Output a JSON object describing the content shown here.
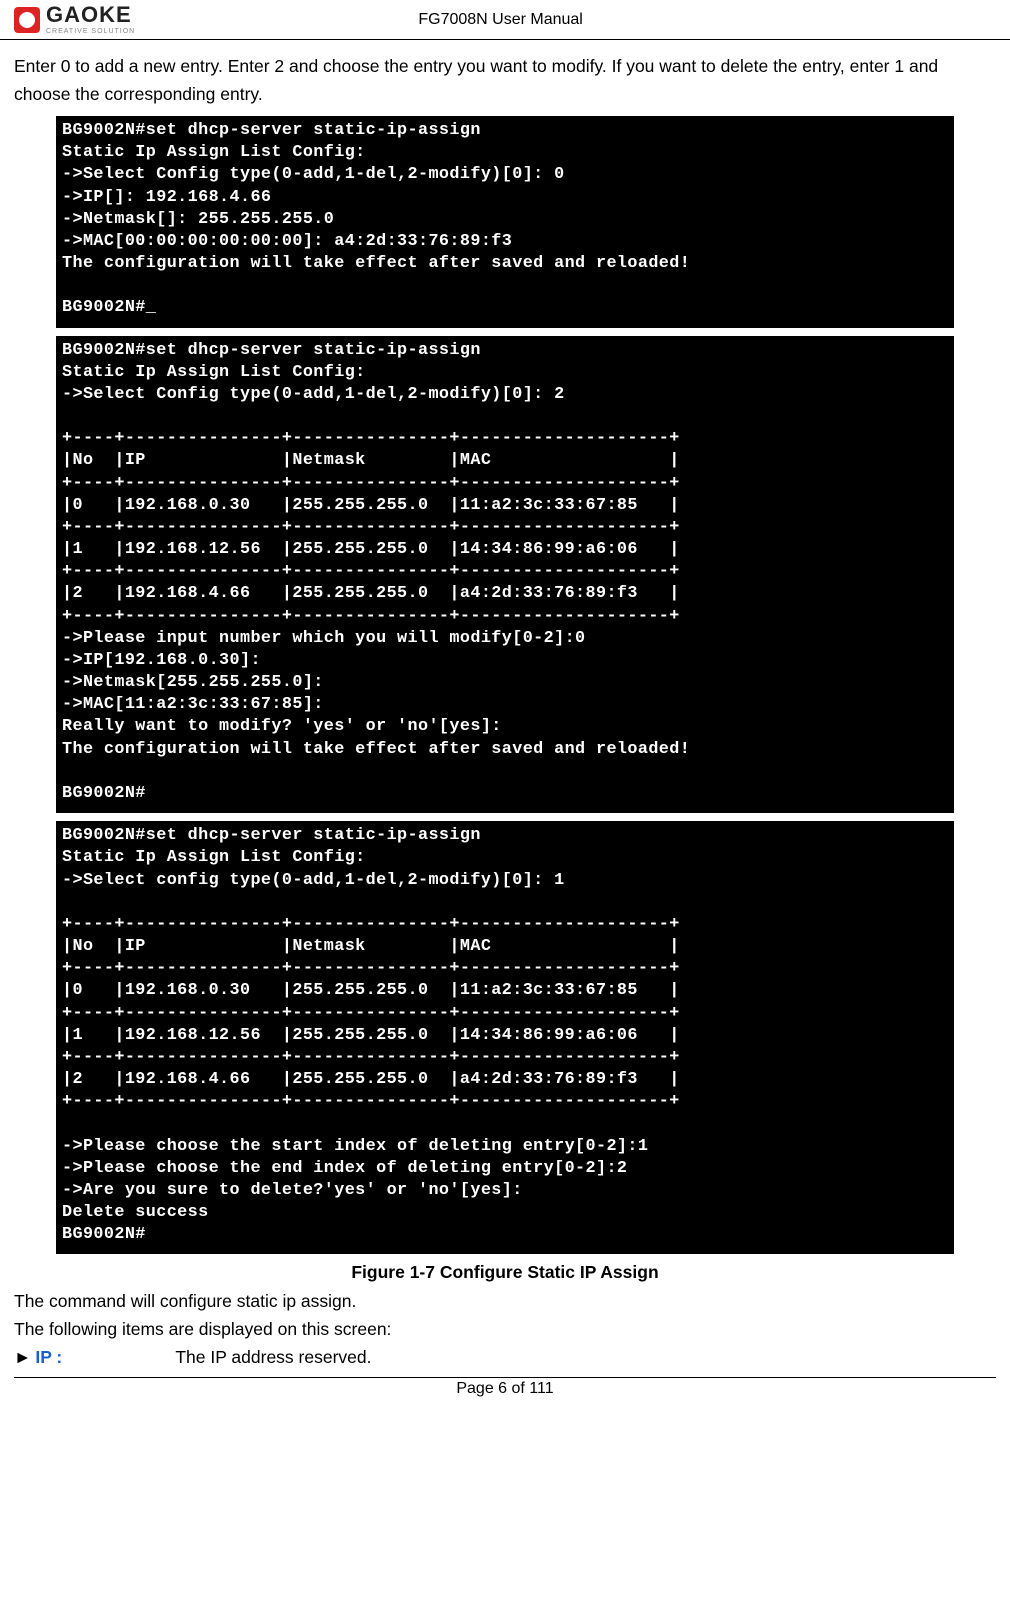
{
  "header": {
    "logo_text": "GAOKE",
    "logo_sub": "CREATIVE SOLUTION",
    "title": "FG7008N User Manual"
  },
  "intro": "Enter 0 to add a new entry. Enter 2 and choose the entry you want to modify. If you want to delete the entry, enter 1 and choose the corresponding entry.",
  "terminals": {
    "t1": "BG9002N#set dhcp-server static-ip-assign\nStatic Ip Assign List Config:\n->Select Config type(0-add,1-del,2-modify)[0]: 0\n->IP[]: 192.168.4.66\n->Netmask[]: 255.255.255.0\n->MAC[00:00:00:00:00:00]: a4:2d:33:76:89:f3\nThe configuration will take effect after saved and reloaded!\n\nBG9002N#_",
    "t2": "BG9002N#set dhcp-server static-ip-assign\nStatic Ip Assign List Config:\n->Select Config type(0-add,1-del,2-modify)[0]: 2\n\n+----+---------------+---------------+--------------------+\n|No  |IP             |Netmask        |MAC                 |\n+----+---------------+---------------+--------------------+\n|0   |192.168.0.30   |255.255.255.0  |11:a2:3c:33:67:85   |\n+----+---------------+---------------+--------------------+\n|1   |192.168.12.56  |255.255.255.0  |14:34:86:99:a6:06   |\n+----+---------------+---------------+--------------------+\n|2   |192.168.4.66   |255.255.255.0  |a4:2d:33:76:89:f3   |\n+----+---------------+---------------+--------------------+\n->Please input number which you will modify[0-2]:0\n->IP[192.168.0.30]:\n->Netmask[255.255.255.0]:\n->MAC[11:a2:3c:33:67:85]:\nReally want to modify? 'yes' or 'no'[yes]:\nThe configuration will take effect after saved and reloaded!\n\nBG9002N#",
    "t3": "BG9002N#set dhcp-server static-ip-assign\nStatic Ip Assign List Config:\n->Select config type(0-add,1-del,2-modify)[0]: 1\n\n+----+---------------+---------------+--------------------+\n|No  |IP             |Netmask        |MAC                 |\n+----+---------------+---------------+--------------------+\n|0   |192.168.0.30   |255.255.255.0  |11:a2:3c:33:67:85   |\n+----+---------------+---------------+--------------------+\n|1   |192.168.12.56  |255.255.255.0  |14:34:86:99:a6:06   |\n+----+---------------+---------------+--------------------+\n|2   |192.168.4.66   |255.255.255.0  |a4:2d:33:76:89:f3   |\n+----+---------------+---------------+--------------------+\n\n->Please choose the start index of deleting entry[0-2]:1\n->Please choose the end index of deleting entry[0-2]:2\n->Are you sure to delete?'yes' or 'no'[yes]:\nDelete success\nBG9002N#"
  },
  "figure_caption": "Figure 1-7    Configure Static IP Assign",
  "after1": "The command will configure static ip assign.",
  "after2": "The following items are displayed on this screen:",
  "item_ip_label": "IP :",
  "item_ip_desc": "The IP address reserved.",
  "footer": "Page 6 of 111"
}
